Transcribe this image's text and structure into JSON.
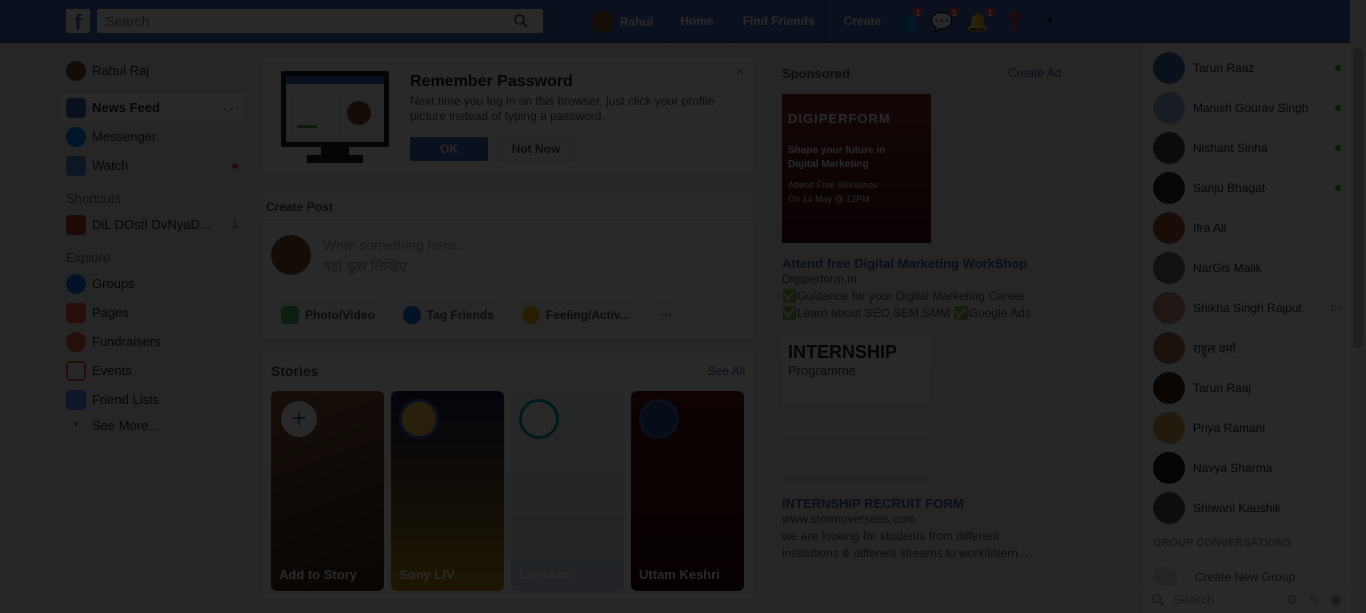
{
  "topbar": {
    "search_placeholder": "Search",
    "user_name": "Rahul",
    "links": [
      "Home",
      "Find Friends",
      "Create"
    ],
    "badges": {
      "friend_requests": "1",
      "messages": "1",
      "notifications": "1"
    }
  },
  "leftnav": {
    "profile": "Rahul Raj",
    "items": [
      {
        "label": "News Feed",
        "icon": "news-feed-icon"
      },
      {
        "label": "Messenger",
        "icon": "messenger-icon"
      },
      {
        "label": "Watch",
        "icon": "watch-icon"
      }
    ],
    "shortcuts_title": "Shortcuts",
    "shortcut": {
      "label": "DiL DOstI DvNyaD...",
      "count": "1"
    },
    "explore_title": "Explore",
    "explore": [
      {
        "label": "Groups",
        "icon": "groups-icon"
      },
      {
        "label": "Pages",
        "icon": "pages-icon"
      },
      {
        "label": "Fundraisers",
        "icon": "fundraisers-icon"
      },
      {
        "label": "Events",
        "icon": "events-icon"
      },
      {
        "label": "Friend Lists",
        "icon": "friend-lists-icon"
      }
    ],
    "see_more": "See More..."
  },
  "remember": {
    "title": "Remember Password",
    "text": "Next time you log in on this browser, just click your profile picture instead of typing a password.",
    "ok": "OK",
    "not_now": "Not Now",
    "close": "×"
  },
  "create_post": {
    "title": "Create Post",
    "placeholder_en": "Write something here...",
    "placeholder_hi": "यहां कुछ लिखिए",
    "actions": [
      "Photo/Video",
      "Tag Friends",
      "Feeling/Activ..."
    ],
    "more": "···"
  },
  "stories": {
    "title": "Stories",
    "see_all": "See All",
    "items": [
      "Add to Story",
      "Sony LIV",
      "Lenskart",
      "Uttam Keshri"
    ]
  },
  "sponsored": {
    "title": "Sponsored",
    "create_ad": "Create Ad",
    "ads": [
      {
        "headline": "Attend free Digital Marketing WorkShop",
        "lines": [
          "Digiperform.in",
          "✅Guidance for your Digital Marketing Career",
          "✅Learn about SEO,SEM,SMM ✅Google Ads"
        ],
        "image_text": [
          "DIGIPERFORM",
          "Shape your future in",
          "Digital Marketing",
          "Attend Free Workshop",
          "On 14 May @ 12PM"
        ]
      },
      {
        "headline": "INTERNSHIP RECRUIT FORM",
        "lines": [
          "www.stormoverseas.com",
          "we are looking for students from different",
          "institutions & different streams to work/intern..."
        ],
        "image_text": [
          "INTERNSHIP",
          "Programme"
        ]
      }
    ]
  },
  "chat": {
    "contacts": [
      {
        "name": "Tarun Raaz",
        "status": "online"
      },
      {
        "name": "Manish Gourav Singh",
        "status": "online"
      },
      {
        "name": "Nishant Sinha",
        "status": "online"
      },
      {
        "name": "Sanju Bhagat",
        "status": "online"
      },
      {
        "name": "Ifra Ali",
        "status": ""
      },
      {
        "name": "NarGis Malik",
        "status": ""
      },
      {
        "name": "Shikha Singh Rajput",
        "status": "1m"
      },
      {
        "name": "राहुल वर्मा",
        "status": ""
      },
      {
        "name": "Tarun Raaj",
        "status": ""
      },
      {
        "name": "Priya Ramani",
        "status": ""
      },
      {
        "name": "Navya Sharma",
        "status": ""
      },
      {
        "name": "Shiwani Kaushik",
        "status": ""
      }
    ],
    "group_title": "GROUP CONVERSATIONS",
    "create_group": "Create New Group",
    "search": "Search"
  },
  "colors": {
    "brand": "#4267b2",
    "overlay": "rgba(0,0,0,0.84)",
    "online": "#42b72a",
    "badge": "#fa3e3e"
  }
}
